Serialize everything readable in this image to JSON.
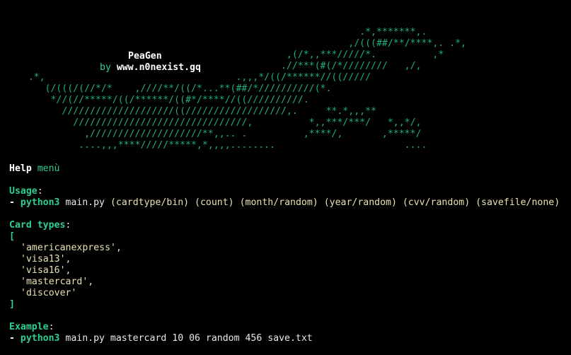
{
  "banner": {
    "ascii_lines": [
      "                                                                .*,*******,.",
      "                                                              ,/(((##/**/****,. .*,",
      "                                                   ,(/*,,***/////*.          ,*",
      "                                                  .//***(#(/*////////   ,/,",
      "     .*,                                  .,,,*/((/******//((/////",
      "        (/(((/(//*/*    ,////**/((/*...**(##/*//////////(*.",
      "         *//(//*****/((/******/((#*/****//((//////////.",
      "           ////////////////////((//////////////////,.     **.*,,,**",
      "             ///////////////////////////////,          *,,***/***/   *,,*/,",
      "               ,////////////////////**,,.. .          ,****/,       ,*****/",
      "              ....,,,****/////*****,*,,,,........                       ...."
    ],
    "title": "PeaGen",
    "by_label": "by",
    "website": "www.n0nexist.gq"
  },
  "help": {
    "word": "Help",
    "menu": "menù"
  },
  "usage": {
    "label": "Usage",
    "colon": ":",
    "dash": "- ",
    "cmd": "python3",
    "script": " main.py ",
    "args": [
      "(cardtype/bin)",
      "(count)",
      "(month/random)",
      "(year/random)",
      "(cvv/random)",
      "(savefile/none)"
    ]
  },
  "card_types": {
    "label": "Card types",
    "colon": ":",
    "open": "[",
    "close": "]",
    "items": [
      "'americanexpress',",
      "'visa13',",
      "'visa16',",
      "'mastercard',",
      "'discover'"
    ]
  },
  "example": {
    "label": "Example",
    "colon": ":",
    "dash": "- ",
    "cmd": "python3",
    "rest": " main.py mastercard 10 06 random 456 save.txt"
  },
  "colors": {
    "background": "#000000",
    "accent_green": "#2fcf8f",
    "text": "#e8e8e8"
  }
}
